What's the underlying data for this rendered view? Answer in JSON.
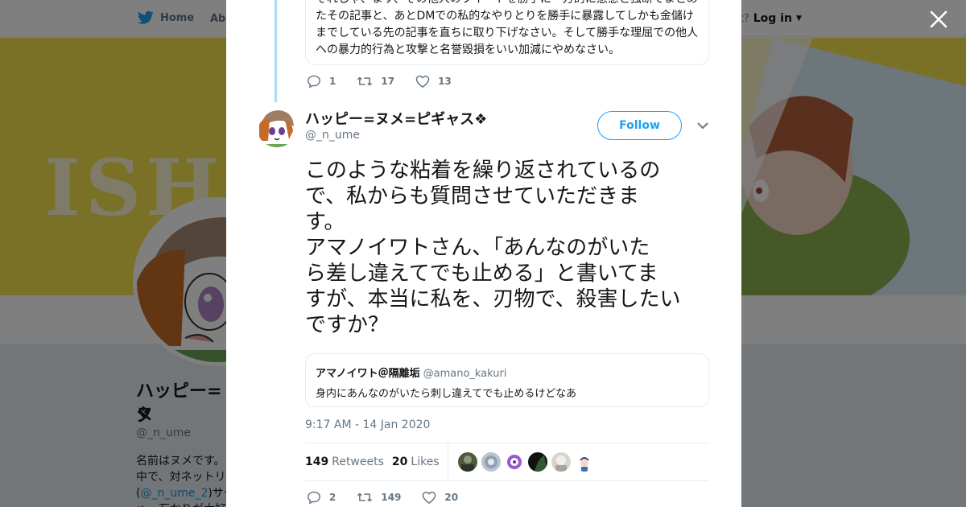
{
  "nav": {
    "home": "Home",
    "about": "Abo",
    "account_q": "ccount?",
    "login": "Log in"
  },
  "banner": {
    "text": "ISHI"
  },
  "profile": {
    "name": "ハッピー=ヌ",
    "diamond": "❖",
    "handle": "@_n_ume",
    "bio_line1": "名前はヌメです。",
    "bio_line2": "中で、対ネットリ",
    "bio_line3_open": "(",
    "bio_line3_link": "@_n_ume_2",
    "bio_line3_rest": ")サー",
    "bio_line4": "ゅ。石かりが大好"
  },
  "previous_tweet": {
    "lines": [
      "それしゃ、ます、その他人のツイートを勝手に一方的に悪意と独断でまとめ",
      "たその記事と、あとDMでの私的なやりとりを勝手に暴露してしかも金儲け",
      "までしている先の記事を直ちに取り下げなさい。そして勝手な理屈での他人",
      "への暴力的行為と攻撃と名誉毀損をいい加減にやめなさい。"
    ],
    "replies": "1",
    "retweets": "17",
    "likes": "13"
  },
  "tweet": {
    "name": "ハッピー=ヌメ=ピギャス❖",
    "handle": "@_n_ume",
    "follow_label": "Follow",
    "text_lines": [
      "このような粘着を繰り返されているの",
      "で、私からも質問させていただきま",
      "す。",
      "アマノイワトさん、「あんなのがいた",
      "ら差し違えてでも止める」と書いてま",
      "すが、本当に私を、刃物で、殺害したい",
      "ですか？"
    ],
    "quote": {
      "name": "アマノイワト＠隔離垢",
      "handle": "@amano_kakuri",
      "text": "身内にあんなのがいたら刺し違えてでも止めるけどなあ"
    },
    "timestamp": "9:17 AM - 14 Jan 2020",
    "retweet_count": "149",
    "retweet_label": "Retweets",
    "like_count": "20",
    "like_label": "Likes",
    "likers": [
      "liker-1",
      "liker-2",
      "liker-3",
      "liker-4",
      "liker-5",
      "liker-6"
    ],
    "action_replies": "2",
    "action_retweets": "149",
    "action_likes": "20"
  },
  "colors": {
    "accent": "#1da1f2",
    "banner": "#f6e24c",
    "muted": "#657786"
  }
}
